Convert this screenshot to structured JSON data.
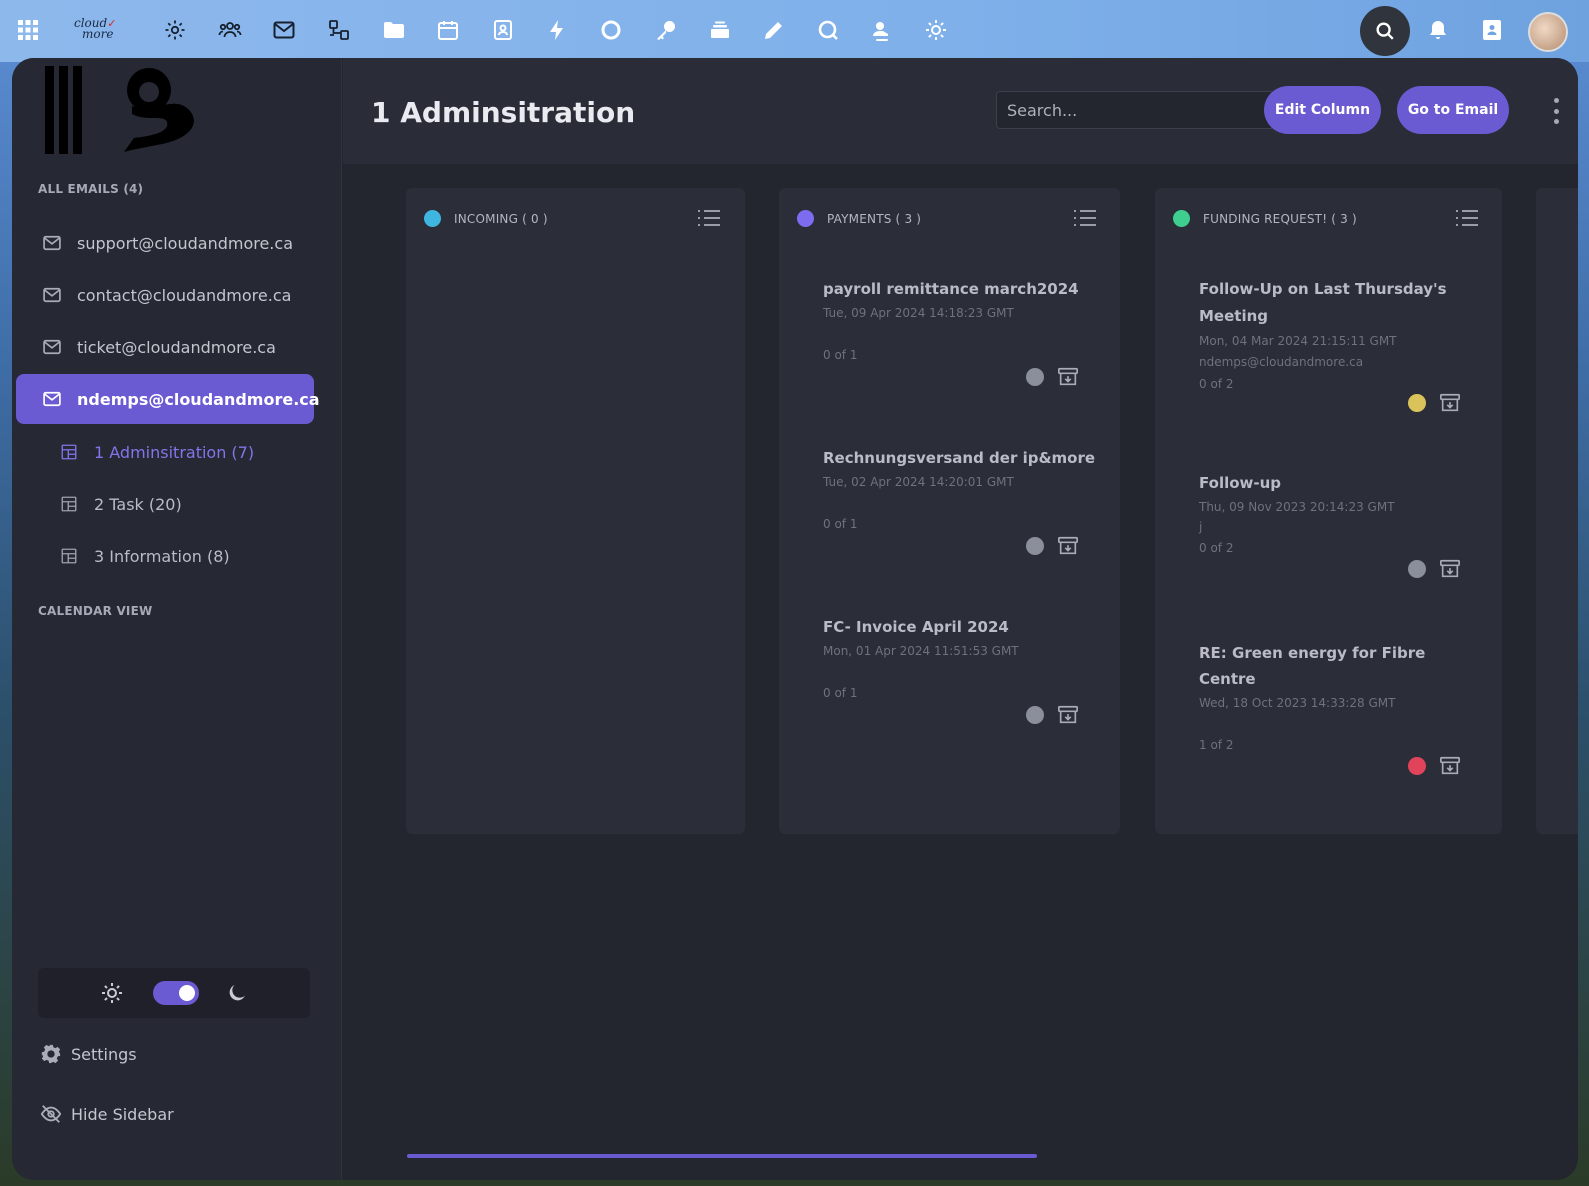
{
  "topbar": {
    "logo_line1": "cloud",
    "logo_line2": "more",
    "icons": [
      "apps-grid-icon",
      "settings-cog-icon",
      "users-icon",
      "mail-icon",
      "tasks-icon",
      "folder-icon",
      "calendar-icon",
      "contacts-icon",
      "flash-icon",
      "circle-icon",
      "key-icon",
      "stack-icon",
      "pencil-icon",
      "chat-icon",
      "agent-icon",
      "sun-settings-icon",
      "search-icon",
      "bell-icon",
      "id-card-icon"
    ]
  },
  "header": {
    "title": "1 Adminsitration",
    "search_placeholder": "Search...",
    "edit_column": "Edit Column",
    "go_to_email": "Go to Email"
  },
  "sidebar": {
    "all_emails": "ALL EMAILS (4)",
    "accounts": [
      {
        "label": "support@cloudandmore.ca",
        "active": false
      },
      {
        "label": "contact@cloudandmore.ca",
        "active": false
      },
      {
        "label": "ticket@cloudandmore.ca",
        "active": false
      },
      {
        "label": "ndemps@cloudandmore.ca",
        "active": true
      }
    ],
    "boards": [
      {
        "label": "1 Adminsitration (7)",
        "active": true
      },
      {
        "label": "2 Task (20)",
        "active": false
      },
      {
        "label": "3 Information (8)",
        "active": false
      }
    ],
    "calendar_view": "CALENDAR VIEW",
    "settings": "Settings",
    "hide_sidebar": "Hide Sidebar",
    "dark_mode": true
  },
  "columns": [
    {
      "title": "INCOMING ( 0 )",
      "color": "#3fb6e0",
      "cards": []
    },
    {
      "title": "PAYMENTS ( 3 )",
      "color": "#7e6cf0",
      "cards": [
        {
          "title": "payroll remittance march2024",
          "date": "Tue, 09 Apr 2024 14:18:23 GMT",
          "extra": "",
          "count": "0 of 1",
          "status_color": "#8a8f9b"
        },
        {
          "title": "Rechnungsversand der ip&more",
          "date": "Tue, 02 Apr 2024 14:20:01 GMT",
          "extra": "",
          "count": "0 of 1",
          "status_color": "#8a8f9b"
        },
        {
          "title": "FC- Invoice April 2024",
          "date": "Mon, 01 Apr 2024 11:51:53 GMT",
          "extra": "",
          "count": "0 of 1",
          "status_color": "#8a8f9b"
        }
      ]
    },
    {
      "title": "FUNDING REQUEST! ( 3 )",
      "color": "#3ecf8e",
      "cards": [
        {
          "title1": "Follow-Up on Last Thursday's",
          "title2": "Meeting",
          "date": "Mon, 04 Mar 2024 21:15:11 GMT",
          "extra": "ndemps@cloudandmore.ca",
          "count": "0 of 2",
          "status_color": "#d9c35a"
        },
        {
          "title1": "Follow-up",
          "title2": "",
          "date": "Thu, 09 Nov 2023 20:14:23 GMT",
          "extra": "j",
          "count": "0 of 2",
          "status_color": "#8a8f9b"
        },
        {
          "title1": "RE: Green energy for Fibre",
          "title2": "Centre",
          "date": "Wed, 18 Oct 2023 14:33:28 GMT",
          "extra": "",
          "count": "1 of 2",
          "status_color": "#e0435a"
        }
      ]
    }
  ]
}
